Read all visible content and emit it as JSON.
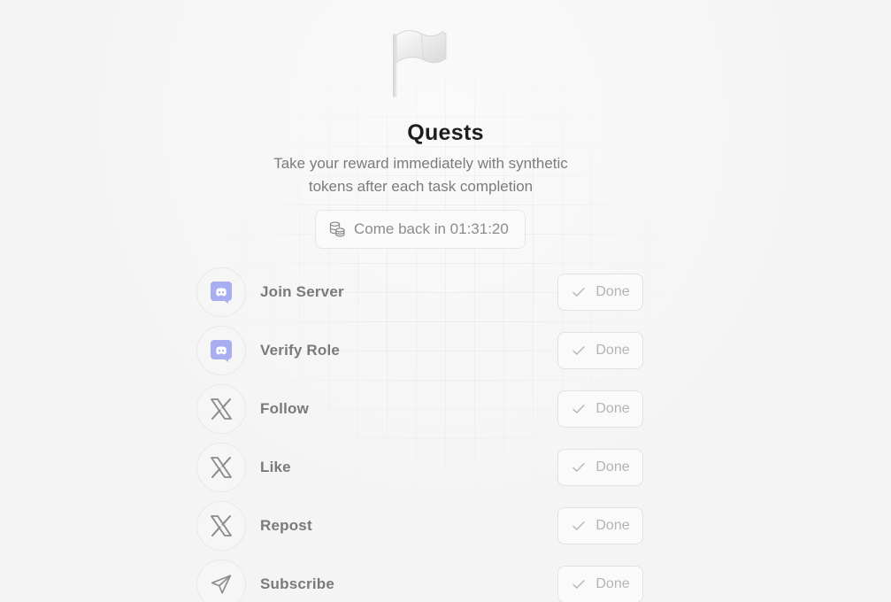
{
  "header": {
    "title": "Quests",
    "subtitle": "Take your reward immediately with synthetic tokens after each task completion",
    "icon": "flag-icon"
  },
  "timer": {
    "text": "Come back in 01:31:20",
    "icon": "coins-icon"
  },
  "quests": [
    {
      "label": "Join Server",
      "icon": "discord-icon",
      "button": "Done"
    },
    {
      "label": "Verify Role",
      "icon": "discord-icon",
      "button": "Done"
    },
    {
      "label": "Follow",
      "icon": "x-logo-icon",
      "button": "Done"
    },
    {
      "label": "Like",
      "icon": "x-logo-icon",
      "button": "Done"
    },
    {
      "label": "Repost",
      "icon": "x-logo-icon",
      "button": "Done"
    },
    {
      "label": "Subscribe",
      "icon": "telegram-icon",
      "button": "Done"
    }
  ],
  "colors": {
    "background": "#f4f4f4",
    "title": "#1e1e1e",
    "discord": "#a9aef0",
    "muted": "#7a7a7a"
  }
}
